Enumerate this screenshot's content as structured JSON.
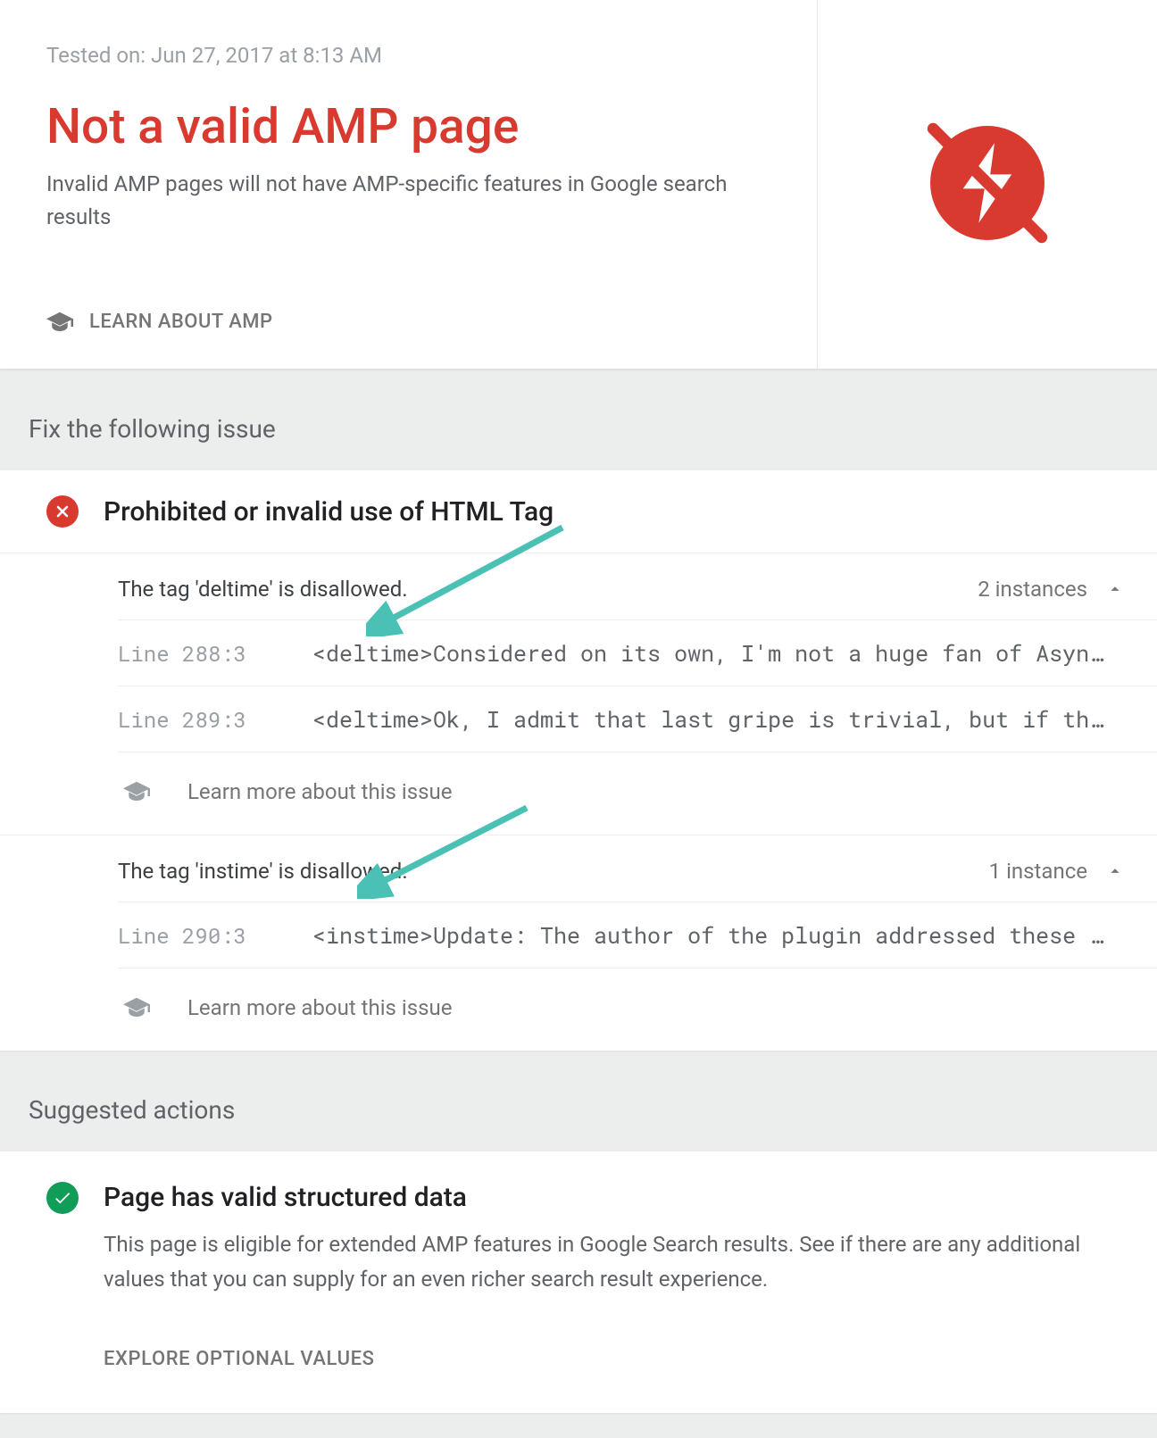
{
  "header": {
    "tested_on": "Tested on: Jun 27, 2017 at 8:13 AM",
    "title": "Not a valid AMP page",
    "subtitle": "Invalid AMP pages will not have AMP-specific features in Google search results",
    "learn_label": "LEARN ABOUT AMP"
  },
  "sections": {
    "fix_heading": "Fix the following issue",
    "suggested_heading": "Suggested actions"
  },
  "issue": {
    "title": "Prohibited or invalid use of HTML Tag",
    "sub_issues": [
      {
        "title": "The tag 'deltime' is disallowed.",
        "instances_label": "2 instances",
        "rows": [
          {
            "line": "Line 288:3",
            "code": "<deltime>Considered on its own, I'm not a huge fan of Asyn…"
          },
          {
            "line": "Line 289:3",
            "code": "<deltime>Ok, I admit that last gripe is trivial, but if th…"
          }
        ],
        "learn_more": "Learn more about this issue"
      },
      {
        "title": "The tag 'instime' is disallowed.",
        "instances_label": "1 instance",
        "rows": [
          {
            "line": "Line 290:3",
            "code": "<instime>Update: The author of the plugin addressed these …"
          }
        ],
        "learn_more": "Learn more about this issue"
      }
    ]
  },
  "suggested": {
    "title": "Page has valid structured data",
    "subtitle": "This page is eligible for extended AMP features in Google Search results. See if there are any additional values that you can supply for an even richer search result experience.",
    "explore_label": "EXPLORE OPTIONAL VALUES"
  },
  "colors": {
    "error": "#d93a30",
    "success": "#0f9d58",
    "arrow": "#4bc0b5"
  }
}
